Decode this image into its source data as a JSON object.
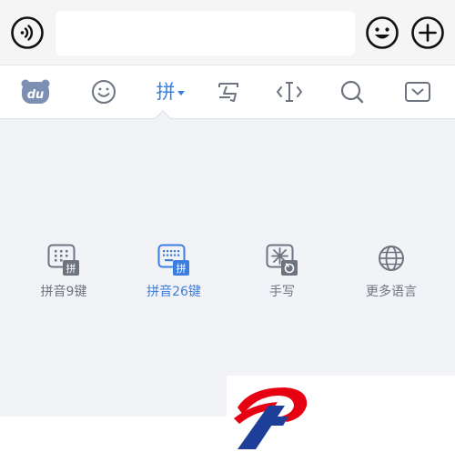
{
  "topbar": {
    "voice_icon": "voice-input-icon",
    "message_placeholder": "",
    "emoji_icon": "smiley-icon",
    "plus_icon": "plus-icon"
  },
  "toolbar": {
    "logo_text": "du",
    "pinyin_label": "拼",
    "items": [
      "du-logo-icon",
      "emoji-icon",
      "pinyin-icon",
      "handwrite-icon",
      "cursor-icon",
      "search-icon",
      "hide-keyboard-icon"
    ]
  },
  "layouts": [
    {
      "label": "拼音9键",
      "badge": "拼",
      "selected": false
    },
    {
      "label": "拼音26键",
      "badge": "拼",
      "selected": true
    },
    {
      "label": "手写",
      "selected": false
    },
    {
      "label": "更多语言",
      "selected": false
    }
  ],
  "colors": {
    "accent": "#3b7ee0",
    "icon_gray": "#6d7480",
    "keyboard_bg": "#f2f3f7",
    "logo_red": "#e60012",
    "logo_blue": "#1d3f9a"
  }
}
